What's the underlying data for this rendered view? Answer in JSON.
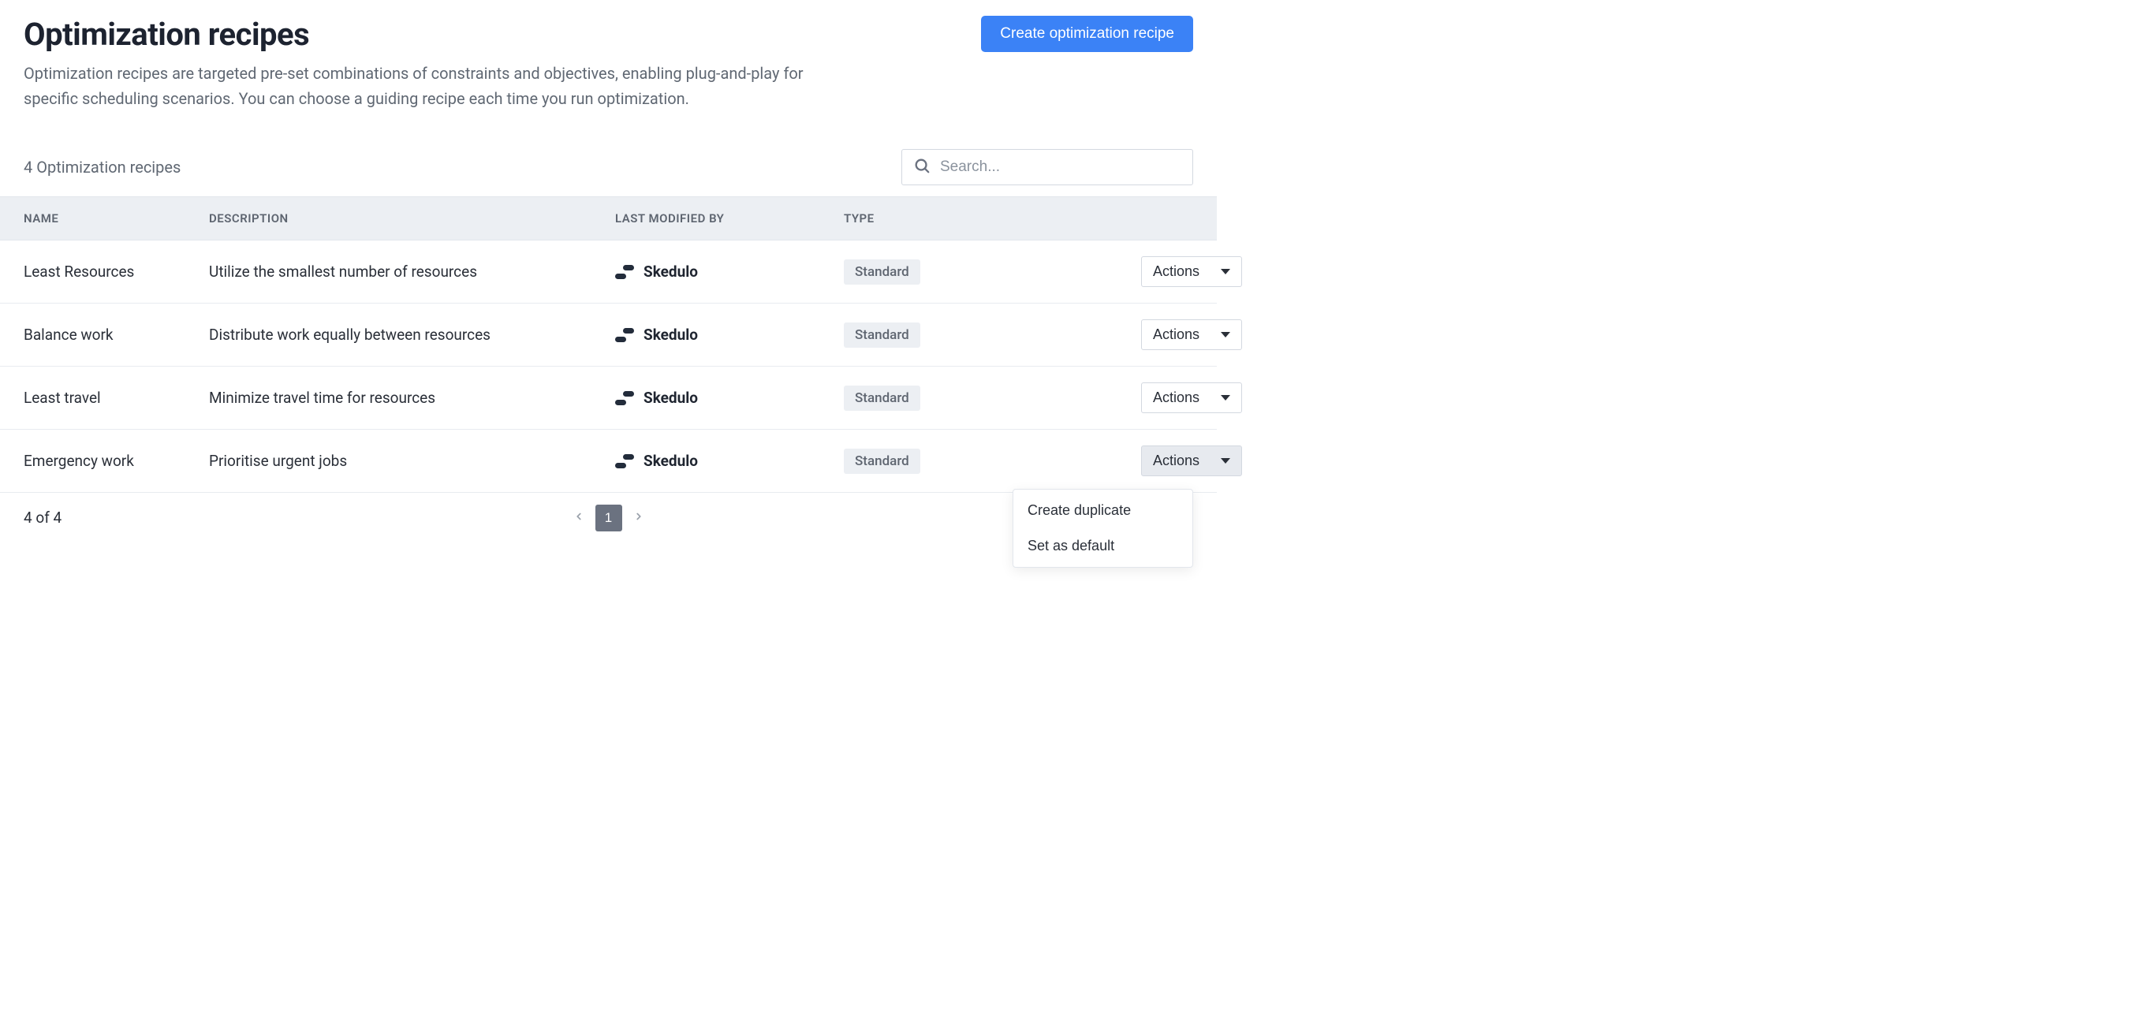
{
  "header": {
    "title": "Optimization recipes",
    "subtitle": "Optimization recipes are targeted pre-set combinations of constraints and objectives, enabling plug-and-play for specific scheduling scenarios. You can choose a guiding recipe each time you run optimization.",
    "create_button": "Create optimization recipe"
  },
  "toolbar": {
    "count_text": "4 Optimization recipes",
    "search_placeholder": "Search..."
  },
  "table": {
    "headers": {
      "name": "NAME",
      "description": "DESCRIPTION",
      "last_modified_by": "LAST MODIFIED BY",
      "type": "TYPE"
    },
    "rows": [
      {
        "name": "Least Resources",
        "description": "Utilize the smallest number of resources",
        "modified_by": "Skedulo",
        "type": "Standard",
        "actions_label": "Actions",
        "open": false
      },
      {
        "name": "Balance work",
        "description": "Distribute work equally between resources",
        "modified_by": "Skedulo",
        "type": "Standard",
        "actions_label": "Actions",
        "open": false
      },
      {
        "name": "Least travel",
        "description": "Minimize travel time for resources",
        "modified_by": "Skedulo",
        "type": "Standard",
        "actions_label": "Actions",
        "open": false
      },
      {
        "name": "Emergency work",
        "description": "Prioritise urgent jobs",
        "modified_by": "Skedulo",
        "type": "Standard",
        "actions_label": "Actions",
        "open": true
      }
    ]
  },
  "actions_menu": {
    "duplicate": "Create duplicate",
    "set_default": "Set as default"
  },
  "pager": {
    "count_text": "4 of 4",
    "current_page": "1"
  }
}
